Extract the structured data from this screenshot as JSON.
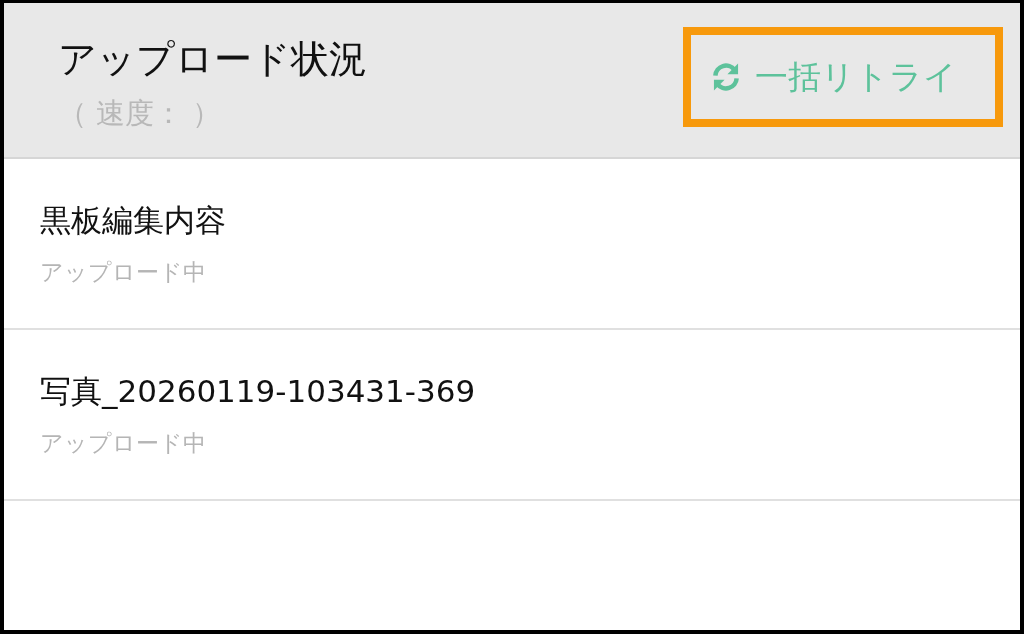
{
  "header": {
    "title": "アップロード状況",
    "subtitle": "（ 速度： ）",
    "retry_button": {
      "label": "一括リトライ",
      "highlighted": true
    }
  },
  "uploads": [
    {
      "name": "黒板編集内容",
      "status": "アップロード中"
    },
    {
      "name": "写真_20260119-103431-369",
      "status": "アップロード中"
    }
  ]
}
